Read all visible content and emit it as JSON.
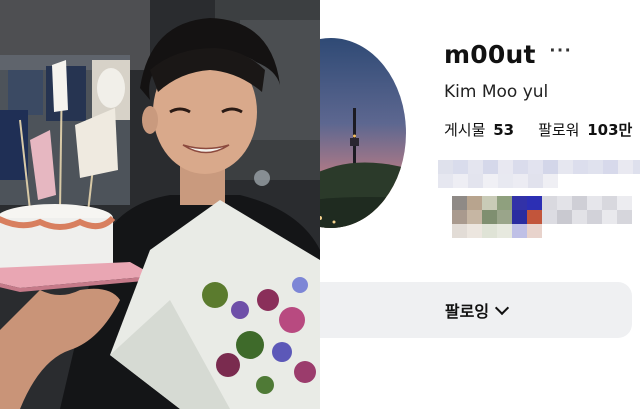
{
  "profile": {
    "username": "m00ut",
    "more_icon": "ellipsis-icon",
    "full_name": "Kim Moo yul",
    "stats": [
      {
        "label": "게시물",
        "value": "53"
      },
      {
        "label": "팔로워",
        "value": "103만"
      }
    ],
    "follow_button": {
      "label": "팔로잉",
      "icon": "chevron-down-icon"
    },
    "bottom_more": "···"
  },
  "colors": {
    "button_bg": "#eff0f2",
    "avatar_sky_top": "#2f4a75",
    "avatar_sky_mid": "#8b6a8a",
    "avatar_sky_bottom": "#e59a6c"
  }
}
